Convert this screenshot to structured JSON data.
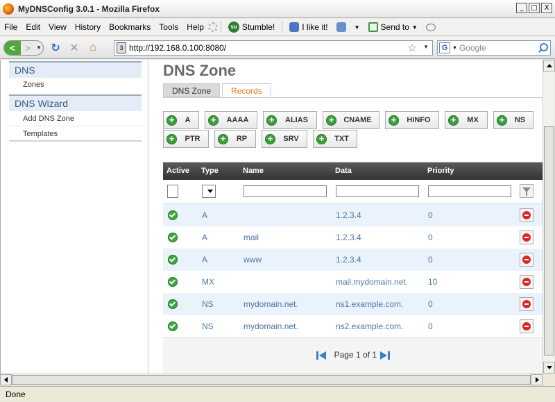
{
  "window": {
    "title": "MyDNSConfig 3.0.1 - Mozilla Firefox",
    "minimize": "_",
    "maximize": "□",
    "close": "X"
  },
  "menu": {
    "items": [
      "File",
      "Edit",
      "View",
      "History",
      "Bookmarks",
      "Tools",
      "Help"
    ]
  },
  "toolbar": {
    "stumble": "Stumble!",
    "like": "I like it!",
    "send_to": "Send to"
  },
  "nav": {
    "url": "http://192.168.0.100:8080/",
    "search_placeholder": "Google",
    "back": "<",
    "forward": ">"
  },
  "sidebar": {
    "section1": {
      "title": "DNS",
      "items": [
        "Zones"
      ]
    },
    "section2": {
      "title": "DNS Wizard",
      "items": [
        "Add DNS Zone",
        "Templates"
      ]
    }
  },
  "main": {
    "title": "DNS Zone",
    "tabs": [
      "DNS Zone",
      "Records"
    ],
    "active_tab": "DNS Zone"
  },
  "record_buttons": [
    "A",
    "AAAA",
    "ALIAS",
    "CNAME",
    "HINFO",
    "MX",
    "NS",
    "PTR",
    "RP",
    "SRV",
    "TXT"
  ],
  "grid": {
    "columns": [
      "Active",
      "Type",
      "Name",
      "Data",
      "Priority"
    ],
    "rows": [
      {
        "type": "A",
        "name": "",
        "data": "1.2.3.4",
        "priority": "0"
      },
      {
        "type": "A",
        "name": "mail",
        "data": "1.2.3.4",
        "priority": "0"
      },
      {
        "type": "A",
        "name": "www",
        "data": "1.2.3.4",
        "priority": "0"
      },
      {
        "type": "MX",
        "name": "",
        "data": "mail.mydomain.net.",
        "priority": "10"
      },
      {
        "type": "NS",
        "name": "mydomain.net.",
        "data": "ns1.example.com.",
        "priority": "0"
      },
      {
        "type": "NS",
        "name": "mydomain.net.",
        "data": "ns2.example.com.",
        "priority": "0"
      }
    ],
    "pager": {
      "label": "Page",
      "current": "1",
      "of": "of",
      "total": "1"
    }
  },
  "status": "Done",
  "colors": {
    "accent_orange": "#e47a12",
    "link_blue": "#4b76a8",
    "active_green": "#3ea63e",
    "delete_red": "#d9262b"
  }
}
